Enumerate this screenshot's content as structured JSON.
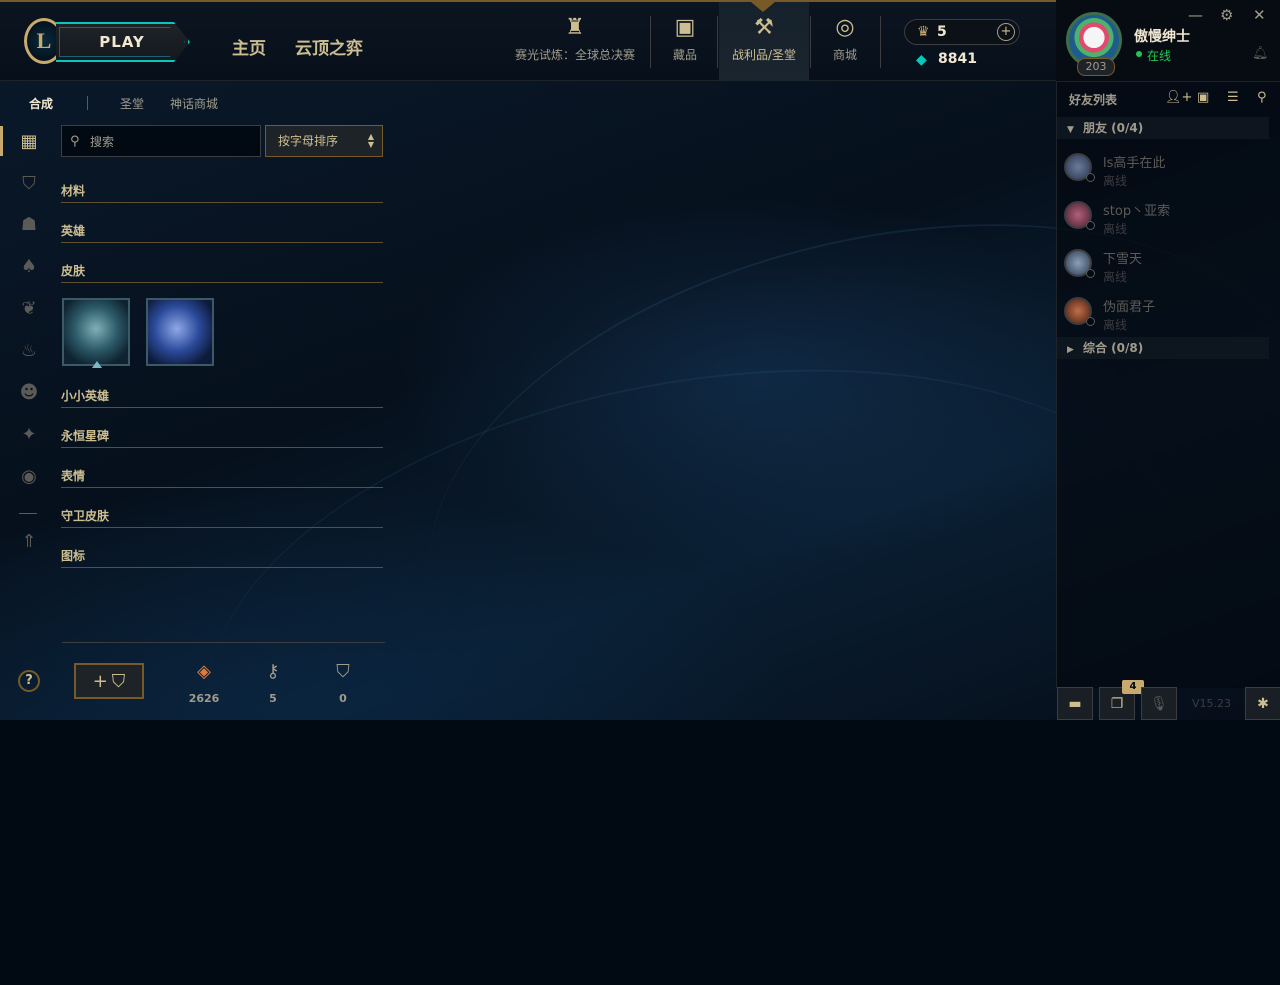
{
  "topbar": {
    "play_label": "PLAY",
    "nav": [
      {
        "label": "主页"
      },
      {
        "label": "云顶之弈"
      }
    ],
    "icon_nav": [
      {
        "label": "赛光试炼：全球总决赛",
        "icon": "worlds-trophy-icon"
      },
      {
        "label": "藏品",
        "icon": "collection-bag-icon"
      },
      {
        "label": "战利品/圣堂",
        "icon": "loot-hammer-icon"
      },
      {
        "label": "商城",
        "icon": "store-coins-icon"
      }
    ],
    "rp_value": "5",
    "be_value": "8841"
  },
  "profile": {
    "username": "傲慢绅士",
    "status": "在线",
    "level": "203",
    "status_color": "#1ec755"
  },
  "subtabs": [
    "合成",
    "圣堂",
    "神话商城"
  ],
  "search": {
    "placeholder": "搜索"
  },
  "sort": {
    "label": "按字母排序"
  },
  "categories": {
    "materials": "材料",
    "champions": "英雄",
    "skins": "皮肤",
    "little_legends": "小小英雄",
    "eternals": "永恒星碑",
    "emotes": "表情",
    "ward_skins": "守卫皮肤",
    "icons": "图标"
  },
  "resources": [
    {
      "icon": "orange-essence-icon",
      "value": "2626"
    },
    {
      "icon": "key-icon",
      "value": "5"
    },
    {
      "icon": "chest-icon",
      "value": "0"
    }
  ],
  "friends": {
    "title": "好友列表",
    "groups": [
      {
        "label": "朋友 (0/4)",
        "expanded": true
      },
      {
        "label": "综合 (0/8)",
        "expanded": false
      }
    ],
    "list": [
      {
        "name": "ls高手在此",
        "status": "离线"
      },
      {
        "name": "stop丶亚索",
        "status": "离线"
      },
      {
        "name": "下雪天",
        "status": "离线"
      },
      {
        "name": "伪面君子",
        "status": "离线"
      }
    ]
  },
  "dock": {
    "badge": "4",
    "version": "V15.23"
  },
  "colors": {
    "gold": "#c8aa6e",
    "teal": "#0ac8b9",
    "online": "#1ec755"
  }
}
